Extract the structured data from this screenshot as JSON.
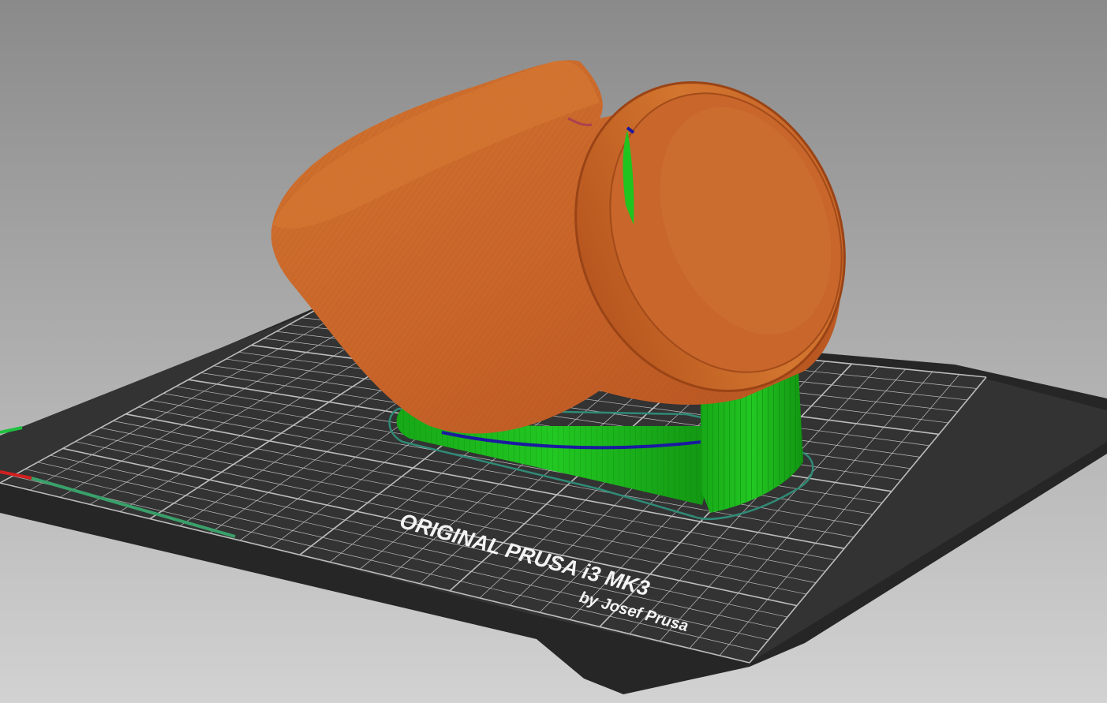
{
  "viewport": {
    "view": "3D gcode preview",
    "background_top": "#8c8c8c",
    "background_bottom": "#cfcfcf"
  },
  "bed": {
    "brand_line": "ORIGINAL PRUSA i3 MK3",
    "maker_line": "by Josef Prusa",
    "surface_color": "#2f2f2f",
    "frame_color": "#262626",
    "grid_color": "#d9d9d9",
    "text_color": "#ffffff"
  },
  "model": {
    "perimeter_color": "#c8622c",
    "support_color": "#1fbf1f",
    "skirt_color": "#2f7f6f",
    "travel_color": "#1a1aa0"
  },
  "axes": {
    "x_color": "#d02020",
    "y_color": "#20c040"
  }
}
